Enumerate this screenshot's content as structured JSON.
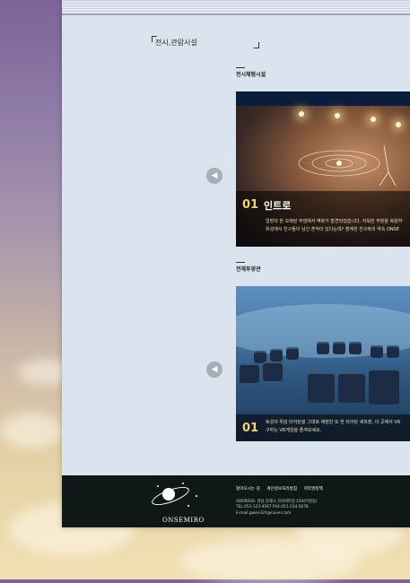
{
  "page_title": "전시,관람시설",
  "sections": [
    {
      "title": "전시체험시설",
      "caption_number": "01",
      "caption_title": "인트로",
      "caption_lines": [
        "일망의 한 오래된 무덤에서 벽화가 발견되었습니다. 지워진 부분을 복원하",
        "위성에서 친구들이 남긴 흔적이 있다는데? 영계한 친구와의 약속 ONSE"
      ]
    },
    {
      "title": "전체투영관",
      "caption_number": "01",
      "caption_title": "",
      "caption_lines": [
        "토성의 위성 타이탄을 그대로 재현한 또 한 타이탄 세트장, 이 곳에서 VR",
        "구하는 VR게임을 즐겨보세요."
      ]
    }
  ],
  "nav": {
    "prev_arrow": "◀"
  },
  "footer": {
    "logo_text": "ONSEMIRO",
    "links": [
      "찾아오시는 길",
      "개인정보처리방침",
      "저작권정책"
    ],
    "address": "ADDRESS: 경남 김해시 가야테마길 254(어방동)",
    "tel_fax": "TEL.051-123-4567   FAX.051-234-5678",
    "email": "E-mail:gwen324@naver.com"
  },
  "colors": {
    "accent": "#f2d27a",
    "footer_bg": "#0f1816",
    "page_bg": "#dbe3ee"
  }
}
